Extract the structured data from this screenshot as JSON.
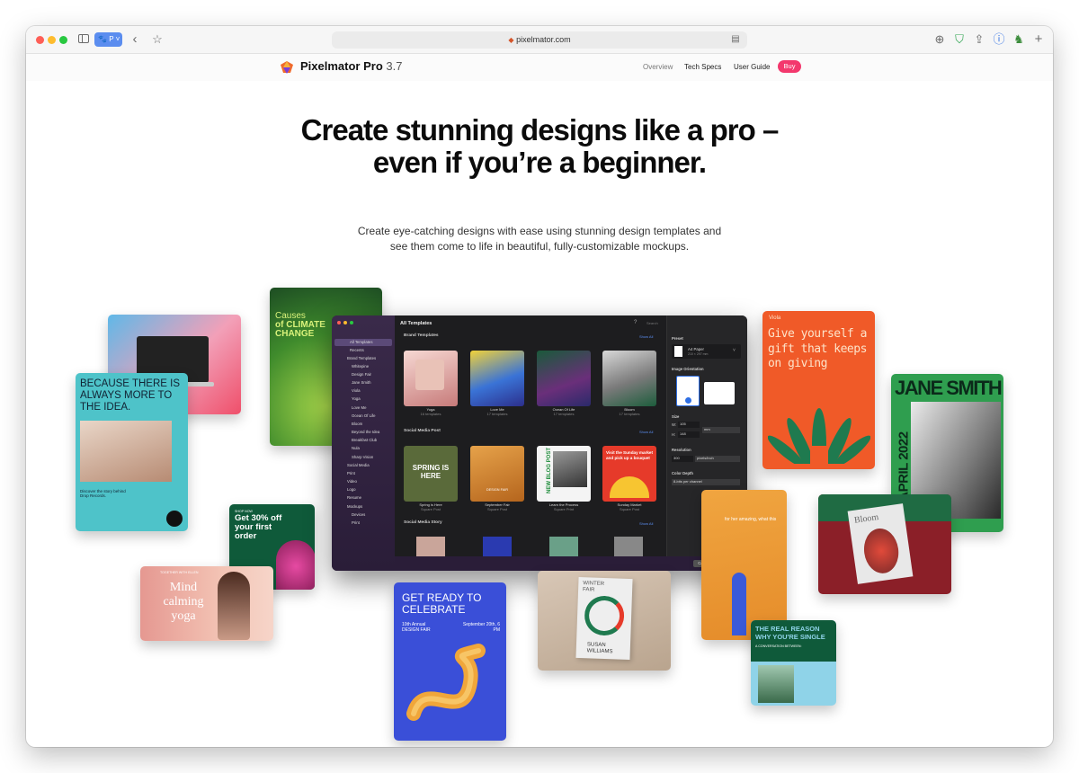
{
  "browser": {
    "tab_pill": "P",
    "url": "pixelmator.com"
  },
  "site": {
    "brand": "Pixelmator Pro",
    "version": "3.7",
    "nav": [
      "Overview",
      "Tech Specs",
      "User Guide"
    ],
    "buy": "Buy"
  },
  "hero": {
    "title": "Create stunning designs like a pro – even if you’re a beginner.",
    "subtitle": "Create eye-catching designs with ease using stunning design templates and see them come to life in beautiful, fully-customizable mockups."
  },
  "cards": {
    "because": "BECAUSE THERE IS ALWAYS MORE TO THE IDEA.",
    "because_sub": "Discover the story behind Drop Records.",
    "climate_a": "Causes",
    "climate_b": "of CLIMATE CHANGE",
    "get30": "Get 30% off your first order",
    "shop_now": "SHOP NOW",
    "mind_top": "TOGETHER WITH ELLEN",
    "mind": "Mind calming yoga",
    "celebrate": "GET READY TO CELEBRATE",
    "celebrate_a": "10th Annual DESIGN FAIR",
    "celebrate_b": "September 20th, 6 PM",
    "winter_a": "WINTER FAIR",
    "winter_b": "SUSAN WILLIAMS",
    "gift_top": "Viola",
    "gift": "Give yourself a gift that keeps on giving",
    "jane": "JANE SMITH",
    "jane_date": "15 APRIL 2022",
    "bloom": "Bloom",
    "real": "THE REAL REASON WHY YOU'RE SINGLE",
    "real_sub": "A CONVERSATION BETWEEN:",
    "orange_text": "for her amazing, what this"
  },
  "app": {
    "title": "All Templates",
    "search_placeholder": "Search",
    "sidebar": [
      "All Templates",
      "Recents",
      "Brand Templates",
      "Whitepine",
      "Design Fair",
      "Jane Smith",
      "Viola",
      "Yoga",
      "Love Me",
      "Ocean Of Life",
      "Bloom",
      "Beyond the Idea",
      "Breakfast Club",
      "Nula",
      "Sharp Vision",
      "Social Media",
      "Print",
      "Video",
      "Logo",
      "Resume",
      "Mockups",
      "Devices",
      "Print"
    ],
    "sections": {
      "brand": "Brand Templates",
      "social_post": "Social Media Post",
      "social_story": "Social Media Story",
      "show_all": "Show All"
    },
    "brand_tiles": [
      {
        "name": "Yoga",
        "count": "16 templates"
      },
      {
        "name": "Love Me",
        "count": "17 templates"
      },
      {
        "name": "Ocean Of Life",
        "count": "17 templates"
      },
      {
        "name": "Bloom",
        "count": "17 templates"
      }
    ],
    "post_tiles": [
      {
        "name": "Spring is Here",
        "kind": "Square Post",
        "art": "SPRING IS HERE"
      },
      {
        "name": "September Fair",
        "kind": "Square Post",
        "art": "DESIGN FAIR"
      },
      {
        "name": "Learn the Process",
        "kind": "Square Print",
        "art": "NEW BLOG POST"
      },
      {
        "name": "Sunday Market",
        "kind": "Square Post",
        "art": "Visit the Sunday market and pick up a bouquet"
      }
    ],
    "right_panel": {
      "preset": "Preset",
      "preset_value": "A4 Paper",
      "preset_size": "210 × 297 mm",
      "orientation": "Image Orientation",
      "size": "Size",
      "w": "W:",
      "w_val": "105",
      "h": "H:",
      "h_val": "148",
      "unit": "mm",
      "resolution": "Resolution",
      "res_val": "300",
      "res_unit": "pixels/inch",
      "depth": "Color Depth",
      "depth_val": "8-bits per channel"
    },
    "cancel": "Cancel",
    "create": "Create"
  },
  "colors": {
    "buy": "#f3386d",
    "accent": "#2f6fe4"
  }
}
